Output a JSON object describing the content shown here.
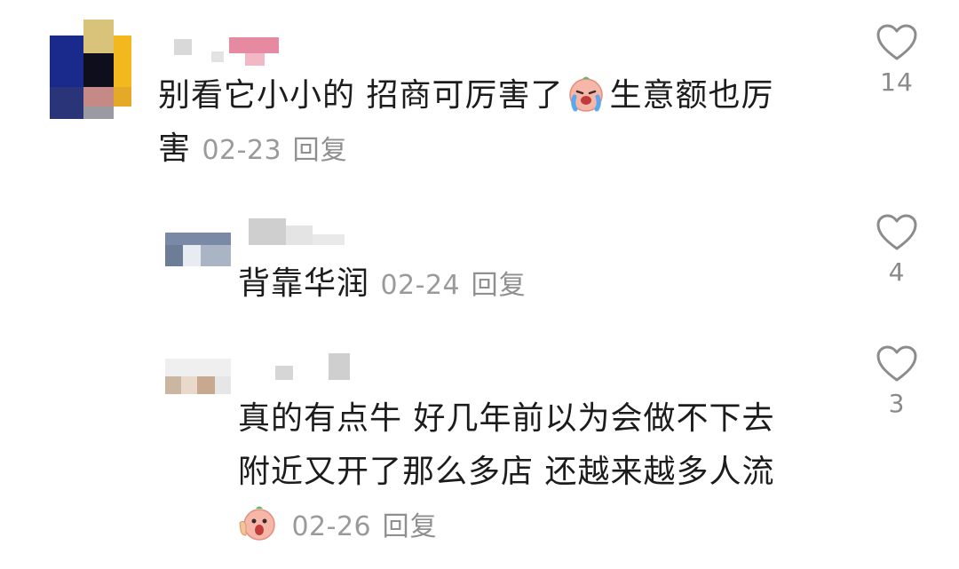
{
  "comments": [
    {
      "text_a": "别看它小小的 招商可厉害了",
      "emoji_1": "crying-face-emoji",
      "text_b": "生意额也厉",
      "text_c": "害",
      "date": "02-23",
      "reply": "回复",
      "likes": "14"
    },
    {
      "text": "背靠华润",
      "date": "02-24",
      "reply": "回复",
      "likes": "4"
    },
    {
      "line1": "真的有点牛 好几年前以为会做不下去",
      "line2": "附近又开了那么多店 还越来越多人流",
      "emoji_1": "shocked-face-emoji",
      "date": "02-26",
      "reply": "回复",
      "likes": "3"
    }
  ],
  "colors": {
    "heart_stroke": "#8c8c8c",
    "meta_text": "#9a9a9a",
    "body_text": "#1c1c1c"
  }
}
